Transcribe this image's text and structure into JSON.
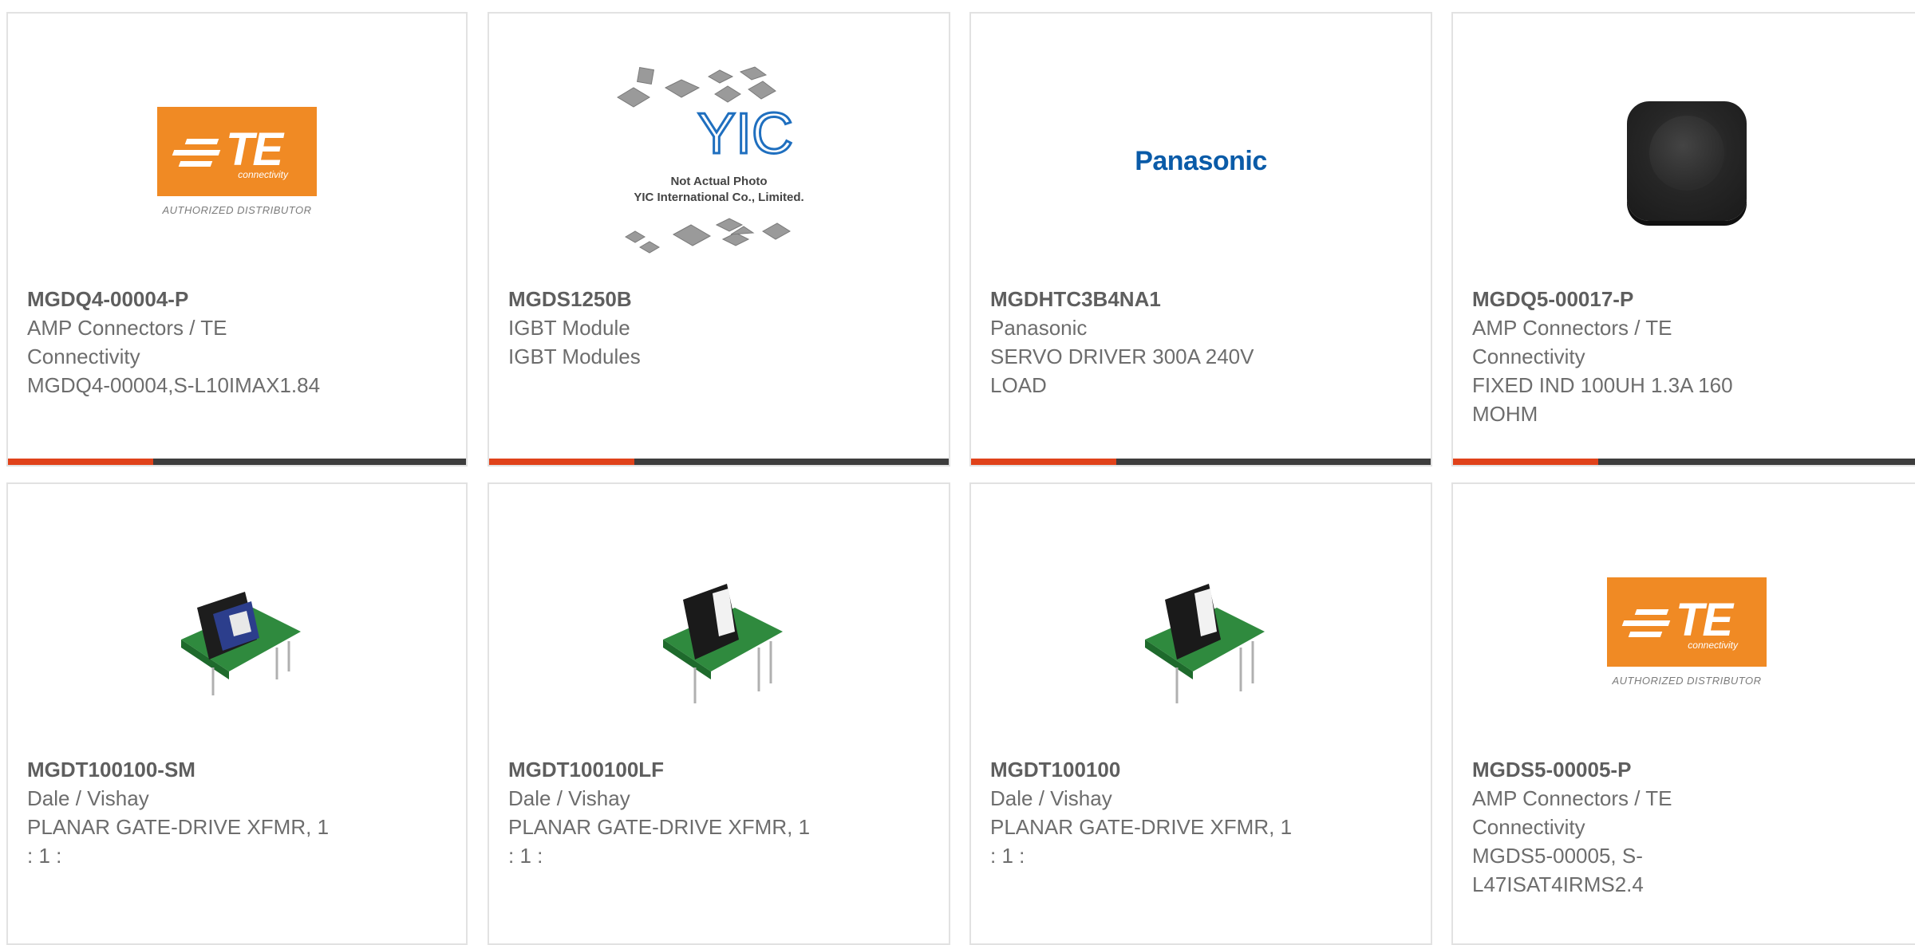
{
  "accent_color": "#e0421a",
  "products": [
    {
      "part_number": "MGDQ4-00004-P",
      "lines": [
        "AMP Connectors / TE",
        "Connectivity",
        "MGDQ4-00004,S-L10IMAX1.84"
      ],
      "image": "te-connectivity-logo",
      "logo": {
        "brand": "TE",
        "sub": "connectivity",
        "caption": "AUTHORIZED DISTRIBUTOR"
      }
    },
    {
      "part_number": "MGDS1250B",
      "lines": [
        "IGBT Module",
        "IGBT Modules"
      ],
      "image": "yic-placeholder",
      "placeholder": {
        "line1": "Not Actual Photo",
        "line2": "YIC International Co., Limited."
      }
    },
    {
      "part_number": "MGDHTC3B4NA1",
      "lines": [
        "Panasonic",
        "SERVO DRIVER 300A 240V",
        "LOAD"
      ],
      "image": "panasonic-logo",
      "logo": {
        "brand": "Panasonic"
      }
    },
    {
      "part_number": "MGDQ5-00017-P",
      "lines": [
        "AMP Connectors / TE",
        "Connectivity",
        "FIXED IND 100UH 1.3A 160",
        "MOHM"
      ],
      "image": "inductor-photo"
    },
    {
      "part_number": "MGDT100100-SM",
      "lines": [
        "Dale / Vishay",
        "PLANAR GATE-DRIVE XFMR, 1",
        ": 1 :"
      ],
      "image": "transformer-photo"
    },
    {
      "part_number": "MGDT100100LF",
      "lines": [
        "Dale / Vishay",
        "PLANAR GATE-DRIVE XFMR, 1",
        ": 1 :"
      ],
      "image": "transformer-photo"
    },
    {
      "part_number": "MGDT100100",
      "lines": [
        "Dale / Vishay",
        "PLANAR GATE-DRIVE XFMR, 1",
        ": 1 :"
      ],
      "image": "transformer-photo"
    },
    {
      "part_number": "MGDS5-00005-P",
      "lines": [
        "AMP Connectors / TE",
        "Connectivity",
        "MGDS5-00005, S-",
        "L47ISAT4IRMS2.4"
      ],
      "image": "te-connectivity-logo",
      "logo": {
        "brand": "TE",
        "sub": "connectivity",
        "caption": "AUTHORIZED DISTRIBUTOR"
      }
    }
  ]
}
